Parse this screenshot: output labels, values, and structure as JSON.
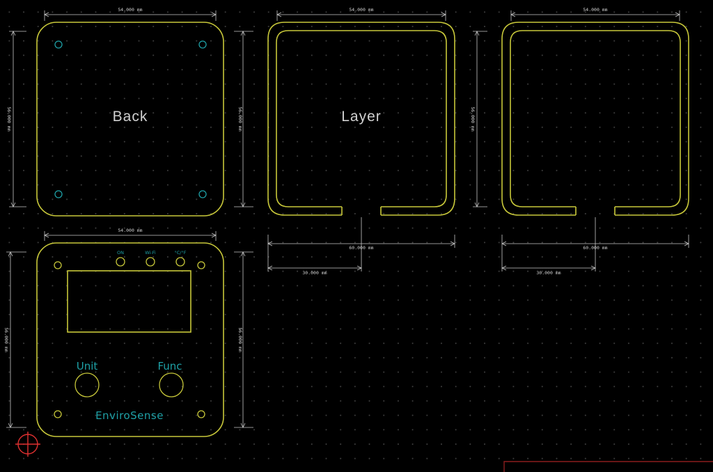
{
  "colors": {
    "background": "#000000",
    "edge_cuts": "#c8c83a",
    "silkscreen": "#1ea0a6",
    "dimension": "#c8c8c8",
    "cursor": "#e03030"
  },
  "panels": {
    "back": {
      "label": "Back"
    },
    "layer": {
      "label": "Layer"
    }
  },
  "dimensions": {
    "width_54": "54.000 mm",
    "height_56": "56.000 mm",
    "width_60": "60.000 mm",
    "gap_30": "30.000 mm"
  },
  "front_panel": {
    "led_on": "ON",
    "led_wifi": "Wi-Fi",
    "led_unit": "°C/°F",
    "button_unit": "Unit",
    "button_func": "Func",
    "brand": "EnviroSense"
  },
  "icons": {
    "cursor": "crosshair-cursor-icon"
  }
}
